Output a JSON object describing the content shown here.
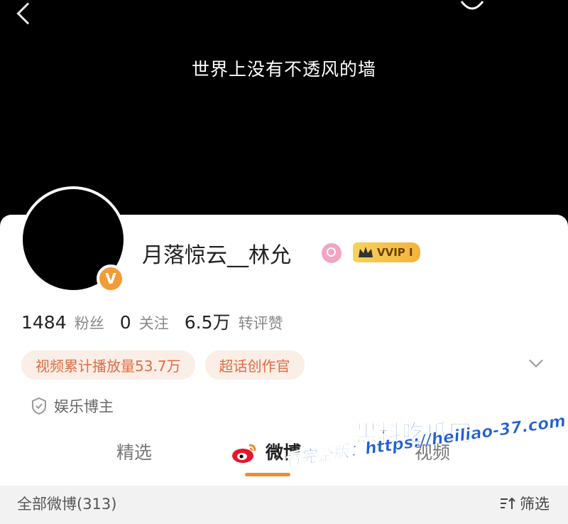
{
  "header": {
    "banner_text": "世界上没有不透风的墙",
    "back_icon": "back-arrow-icon",
    "more_icon": "more-icon"
  },
  "profile": {
    "username": "月落惊云__林允",
    "verify_badge": "V",
    "vvip_label": "VVIP I",
    "stats": [
      {
        "value": "1484",
        "label": "粉丝"
      },
      {
        "value": "0",
        "label": "关注"
      },
      {
        "value": "6.5万",
        "label": "转评赞"
      }
    ],
    "tags": [
      "视频累计播放量53.7万",
      "超话创作官"
    ],
    "category": "娱乐博主"
  },
  "tabs": [
    {
      "label": "精选",
      "active": false
    },
    {
      "label": "微博",
      "active": true
    },
    {
      "label": "视频",
      "active": false
    }
  ],
  "subbar": {
    "all_posts": "全部微博(313)",
    "filter_label": "筛选"
  },
  "watermark": {
    "title": "黑料吃瓜网",
    "url_line": "看完整版：https://heiliao-37.com"
  },
  "colors": {
    "accent_orange": "#f28a2e",
    "tag_text": "#e06c41",
    "tag_bg": "#fbeee7",
    "vvip_gold": "#f2b33b",
    "watermark_blue": "#1f5ed6"
  }
}
